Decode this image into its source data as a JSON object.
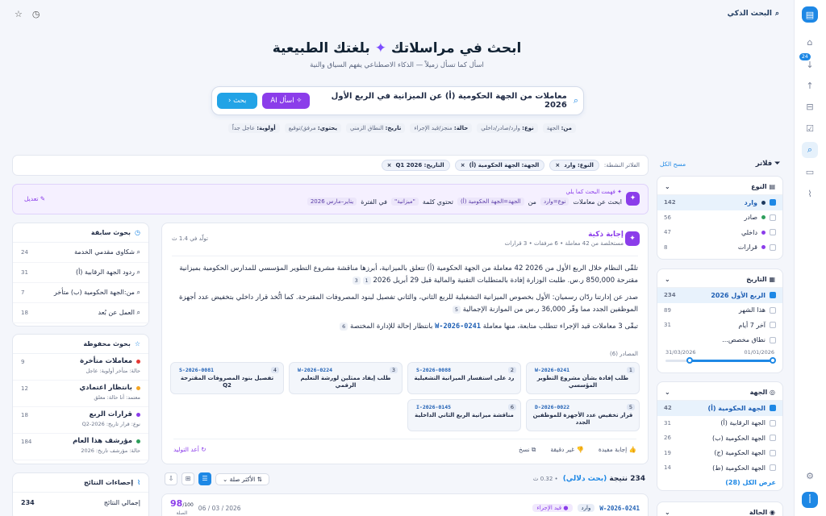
{
  "topbar": {
    "brand": "البحث الذكي"
  },
  "hero": {
    "title_a": "ابحث في مراسلاتك",
    "title_b": "بلغتك الطبيعية",
    "subtitle": "اسأل كما تسأل زميلاً — الذكاء الاصطناعي يفهم السياق والنية"
  },
  "search": {
    "query": "معاملات من الجهة الحكومية (أ) عن الميزانية في الربع الأول 2026",
    "ask_ai": "اسأل AI",
    "search_btn": "بحث"
  },
  "hints": [
    {
      "k": "من:",
      "v": "الجهة"
    },
    {
      "k": "نوع:",
      "v": "وارد/صادر/داخلي"
    },
    {
      "k": "حالة:",
      "v": "منجز/قيد الإجراء"
    },
    {
      "k": "تاريخ:",
      "v": "النطاق الزمني"
    },
    {
      "k": "يحتوي:",
      "v": "مرفق/توقيع"
    },
    {
      "k": "أولوية:",
      "v": "عاجل جداً"
    }
  ],
  "filters": {
    "title": "فلاتر",
    "clear": "مسح الكل",
    "type": {
      "title": "النوع",
      "items": [
        {
          "label": "وارد",
          "count": "142",
          "color": "#1e3a5f",
          "on": true
        },
        {
          "label": "صادر",
          "count": "56",
          "color": "#2e9e5b",
          "on": false
        },
        {
          "label": "داخلي",
          "count": "47",
          "color": "#8b3dea",
          "on": false
        },
        {
          "label": "قرارات",
          "count": "8",
          "color": "#8b3dea",
          "on": false
        }
      ]
    },
    "date": {
      "title": "التاريخ",
      "items": [
        {
          "label": "الربع الأول 2026",
          "count": "234",
          "on": true
        },
        {
          "label": "هذا الشهر",
          "count": "89",
          "on": false
        },
        {
          "label": "آخر 7 أيام",
          "count": "31",
          "on": false
        },
        {
          "label": "نطاق مخصص...",
          "count": "",
          "on": false
        }
      ],
      "range_from": "01/01/2026",
      "range_to": "31/03/2026"
    },
    "entity": {
      "title": "الجهة",
      "items": [
        {
          "label": "الجهة الحكومية (أ)",
          "count": "42",
          "on": true
        },
        {
          "label": "الجهة الرقابية (أ)",
          "count": "31",
          "on": false
        },
        {
          "label": "الجهة الحكومية (ب)",
          "count": "26",
          "on": false
        },
        {
          "label": "الجهة الحكومية (ج)",
          "count": "19",
          "on": false
        },
        {
          "label": "الجهة الحكومية (ط)",
          "count": "14",
          "on": false
        }
      ],
      "show_all": "عرض الكل (28)"
    },
    "status_title": "الحالة"
  },
  "active": {
    "label": "الفلاتر النشطة:",
    "chips": [
      "النوع: وارد",
      "الجهة: الجهة الحكومية (أ)",
      "التاريخ: Q1 2026"
    ]
  },
  "understood": {
    "line1": "فهمت البحث كما يلي",
    "w1": "ابحث عن معاملات",
    "t1": "نوع=وارد",
    "w2": "من",
    "t2": "الجهة=الجهة الحكومية (أ)",
    "w3": "تحتوي كلمة",
    "t3": "\"ميزانية\"",
    "w4": "في الفترة",
    "t4": "يناير–مارس 2026",
    "edit": "تعديل"
  },
  "answer": {
    "title": "إجابة ذكية",
    "sub": "مستخلصة من 42 معاملة • 6 مرفقات • 3 قرارات",
    "gen": "تولّد في 1.4 ث",
    "p1": "تلقّى النظام خلال الربع الأول من 2026 42 معاملة من الجهة الحكومية (أ) تتعلق بالميزانية، أبرزها مناقشة مشروع التطوير المؤسسي للمدارس الحكومية بميزانية مقترحة 850,000 ر.س. طلبت الوزارة إفادة بالمتطلبات التقنية والمالية قبل 29 أبريل 2026",
    "p2": "صدر عن إدارتنا ردّان رسميان: الأول بخصوص الميزانية التشغيلية للربع الثاني، والثاني تفصيل لبنود المصروفات المقترحة. كما اتُّخذ قرار داخلي بتخفيض عدد أجهزة الموظفين الجدد مما وفّر 36,000 ر.س من الموازنة الإجمالية",
    "p3a": "تبقّى 3 معاملات قيد الإجراء تتطلب متابعة، منها معاملة",
    "p3id": "W-2026-0241",
    "p3b": "بانتظار إحالة للإدارة المختصة",
    "sources_label": "المصادر (6)",
    "sources": [
      {
        "n": "1",
        "id": "W-2026-0241",
        "t": "طلب إفادة بشأن مشروع التطوير المؤسسي"
      },
      {
        "n": "2",
        "id": "S-2026-0088",
        "t": "رد على استفسار الميزانية التشغيلية"
      },
      {
        "n": "3",
        "id": "W-2026-0224",
        "t": "طلب إيفاد ممثلين لورشة التعليم الرقمي"
      },
      {
        "n": "4",
        "id": "S-2026-0081",
        "t": "تفصيل بنود المصروفات المقترحة Q2"
      },
      {
        "n": "5",
        "id": "D-2026-0022",
        "t": "قرار تخفيض عدد الأجهزة للموظفين الجدد"
      },
      {
        "n": "6",
        "id": "I-2026-0145",
        "t": "مناقشة ميزانية الربع الثاني الداخلية"
      }
    ],
    "a_useful": "إجابة مفيدة",
    "a_inaccurate": "غير دقيقة",
    "a_copy": "نسخ",
    "a_regen": "أعد التوليد"
  },
  "results": {
    "count": "234",
    "count_suffix": "نتيجة",
    "semantic": "(بحث دلالي)",
    "time": "0.32 ث",
    "sort": "الأكثر صلة",
    "row_id": "W-2026-0241",
    "row_type": "وارد",
    "row_status": "قيد الإجراء",
    "row_date": "2026 / 03 / 06",
    "row_score": "98",
    "row_score_max": "/100",
    "row_score_label": "الصلة"
  },
  "recent": {
    "title": "بحوث سابقة",
    "items": [
      {
        "label": "شكاوى مقدمي الخدمة",
        "count": "24"
      },
      {
        "label": "ردود الجهة الرقابية (أ)",
        "count": "31"
      },
      {
        "label": "من:الجهة الحكومية (ب) متأخر",
        "count": "7"
      },
      {
        "label": "العمل عن بُعد",
        "count": "18"
      }
    ]
  },
  "saved": {
    "title": "بحوث محفوظة",
    "items": [
      {
        "label": "معاملات متأخرة",
        "meta": "حالة: متأخر  أولوية: عاجل",
        "count": "9",
        "color": "#e53935"
      },
      {
        "label": "بانتظار اعتمادي",
        "meta": "معتمد: أنا  حالة: معلق",
        "count": "12",
        "color": "#f5a623"
      },
      {
        "label": "قرارات الربع",
        "meta": "نوع: قرار  تاريخ: Q2-2026",
        "count": "18",
        "color": "#8b3dea"
      },
      {
        "label": "مؤرشف هذا العام",
        "meta": "حالة: مؤرشف  تاريخ: 2026",
        "count": "184",
        "color": "#2e9e5b"
      }
    ]
  },
  "stats": {
    "title": "إحصاءات النتائج",
    "total_label": "إجمالي النتائج",
    "total": "234"
  }
}
